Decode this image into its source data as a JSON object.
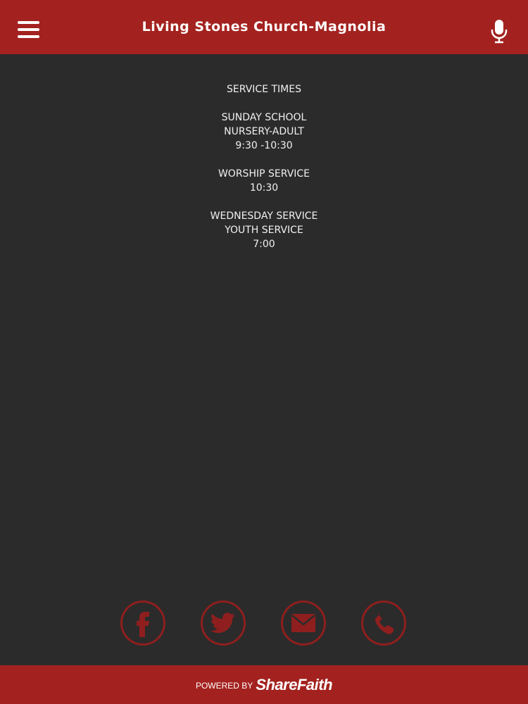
{
  "header": {
    "title": "Living Stones Church-Magnolia",
    "menu_icon": "hamburger-menu-icon",
    "mic_icon": "microphone-icon"
  },
  "content": {
    "lines": [
      "SERVICE TIMES",
      "",
      "SUNDAY SCHOOL",
      "NURSERY-ADULT",
      "9:30 -10:30",
      "",
      "WORSHIP SERVICE",
      "10:30",
      "",
      "WEDNESDAY SERVICE",
      "YOUTH SERVICE",
      "7:00"
    ]
  },
  "social": {
    "items": [
      {
        "icon": "facebook-icon"
      },
      {
        "icon": "twitter-icon"
      },
      {
        "icon": "email-icon"
      },
      {
        "icon": "phone-icon"
      }
    ]
  },
  "footer": {
    "powered_label": "POWERED BY",
    "brand_label": "ShareFaith"
  },
  "colors": {
    "header_bg": "#a3221f",
    "page_bg": "#2b2b2b",
    "social_stroke": "#8e1f1e",
    "text": "#f0f0f0"
  }
}
